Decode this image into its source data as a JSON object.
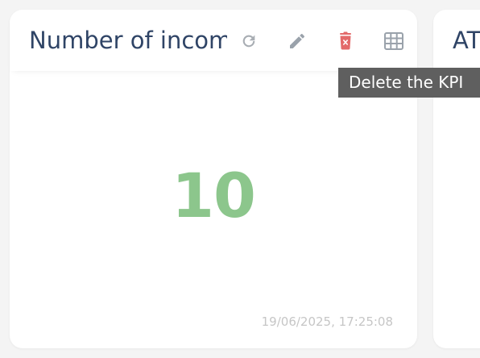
{
  "cards": [
    {
      "title": "Number of incoming",
      "value": "10",
      "timestamp": "19/06/2025, 17:25:08",
      "actions": [
        {
          "name": "refresh",
          "icon": "refresh-icon",
          "color": "#a8adb3"
        },
        {
          "name": "edit",
          "icon": "pencil-icon",
          "color": "#9aa2ab"
        },
        {
          "name": "delete",
          "icon": "trash-icon",
          "color": "#e36a6a"
        },
        {
          "name": "table",
          "icon": "table-icon",
          "color": "#9aa2ab"
        }
      ]
    },
    {
      "title": "AT"
    }
  ],
  "tooltip": {
    "text": "Delete the KPI"
  },
  "colors": {
    "background": "#f4f4f4",
    "card": "#ffffff",
    "title": "#2f4466",
    "value": "#8cc68c",
    "timestamp": "#c6c6c6",
    "tooltip_bg": "#5f5f5f"
  }
}
